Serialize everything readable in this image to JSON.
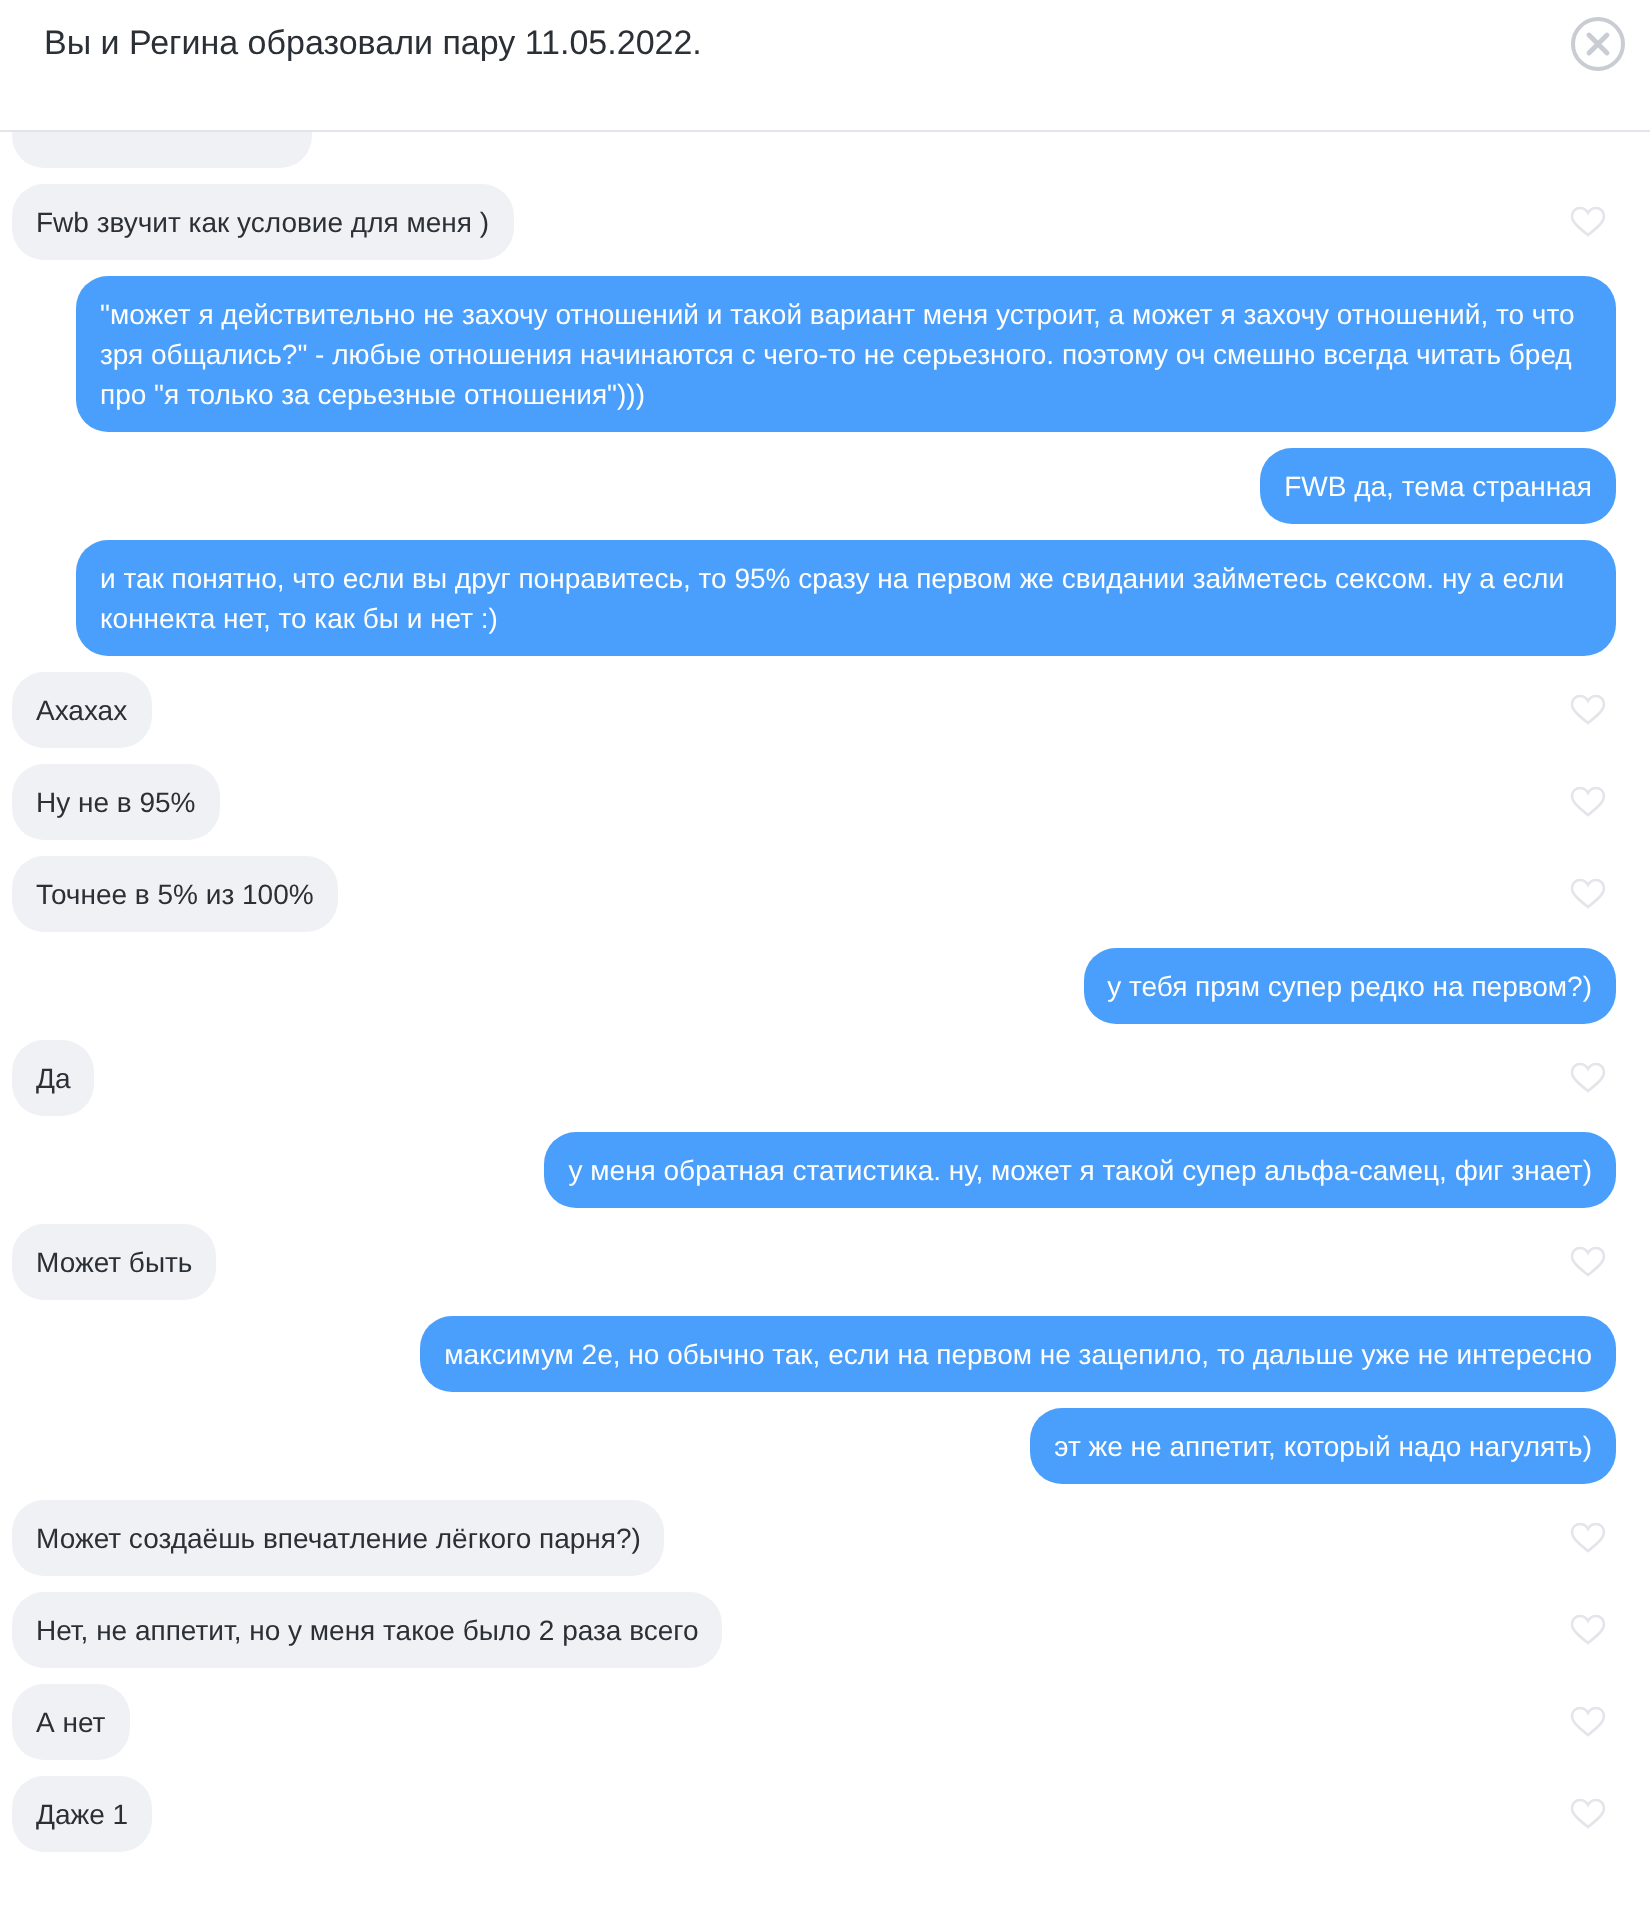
{
  "header": {
    "title": "Вы и Регина образовали пару 11.05.2022."
  },
  "messages": [
    {
      "kind": "hidden"
    },
    {
      "kind": "received",
      "text": "Fwb звучит как условие для меня )"
    },
    {
      "kind": "sent",
      "text": "\"может я действительно не захочу отношений и такой вариант меня устроит, а может я захочу отношений, то что зря общались?\" - любые отношения начинаются с чего-то не серьезного. поэтому оч смешно всегда читать бред про \"я только за серьезные отношения\")))"
    },
    {
      "kind": "sent",
      "text": "FWB да, тема странная"
    },
    {
      "kind": "sent",
      "text": "и так понятно, что если вы друг понравитесь, то 95% сразу на первом же свидании займетесь сексом. ну а если коннекта нет, то как бы и нет :)"
    },
    {
      "kind": "received",
      "text": "Ахахах"
    },
    {
      "kind": "received",
      "text": "Ну не в 95%"
    },
    {
      "kind": "received",
      "text": "Точнее в 5% из 100%"
    },
    {
      "kind": "sent",
      "text": "у тебя прям супер редко на первом?)"
    },
    {
      "kind": "received",
      "text": "Да"
    },
    {
      "kind": "sent",
      "text": "у меня обратная статистика. ну, может я такой супер альфа-самец, фиг знает)"
    },
    {
      "kind": "received",
      "text": "Может быть"
    },
    {
      "kind": "sent",
      "text": "максимум 2е, но обычно так, если на первом не зацепило, то дальше уже не интересно"
    },
    {
      "kind": "sent",
      "text": "эт же не аппетит, который надо нагулять)"
    },
    {
      "kind": "received",
      "text": "Может создаёшь впечатление лёгкого парня?)"
    },
    {
      "kind": "received",
      "text": "Нет, не аппетит, но у меня такое было 2 раза всего"
    },
    {
      "kind": "received",
      "text": "А нет"
    },
    {
      "kind": "received",
      "text": "Даже 1"
    }
  ]
}
